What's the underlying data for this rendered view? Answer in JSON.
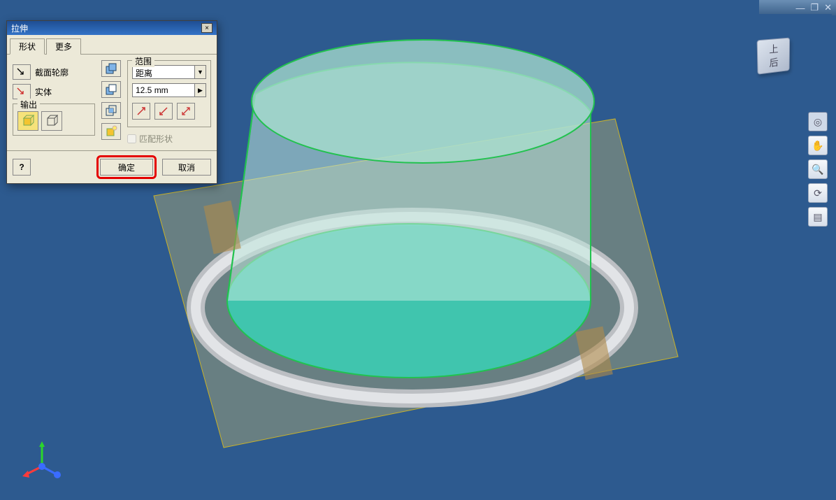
{
  "window": {
    "min_icon": "—",
    "restore_icon": "❐",
    "close_icon": "✕"
  },
  "viewcube": {
    "face_label": "上\n后"
  },
  "nav": {
    "wheel_icon": "◎",
    "pan_icon": "✋",
    "zoom_icon": "🔍",
    "orbit_icon": "⟳",
    "lookat_icon": "▤"
  },
  "dialog": {
    "title": "拉伸",
    "close_icon": "×",
    "tabs": {
      "shape": "形状",
      "more": "更多"
    },
    "profile_label": "截面轮廓",
    "solid_label": "实体",
    "output_group": "输出",
    "extent_group": "范围",
    "extent_mode": "距离",
    "distance_value": "12.5 mm",
    "match_shape_label": "匹配形状",
    "help_icon": "?",
    "ok_label": "确定",
    "cancel_label": "取消"
  },
  "colors": {
    "canvas_bg": "#2d5a8f",
    "extrude_fill": "#7fd9c3",
    "extrude_edge": "#22c24f",
    "sketch_plane": "#d6c66a",
    "part_silver": "#d6d8da",
    "highlight_red": "#e40000"
  }
}
